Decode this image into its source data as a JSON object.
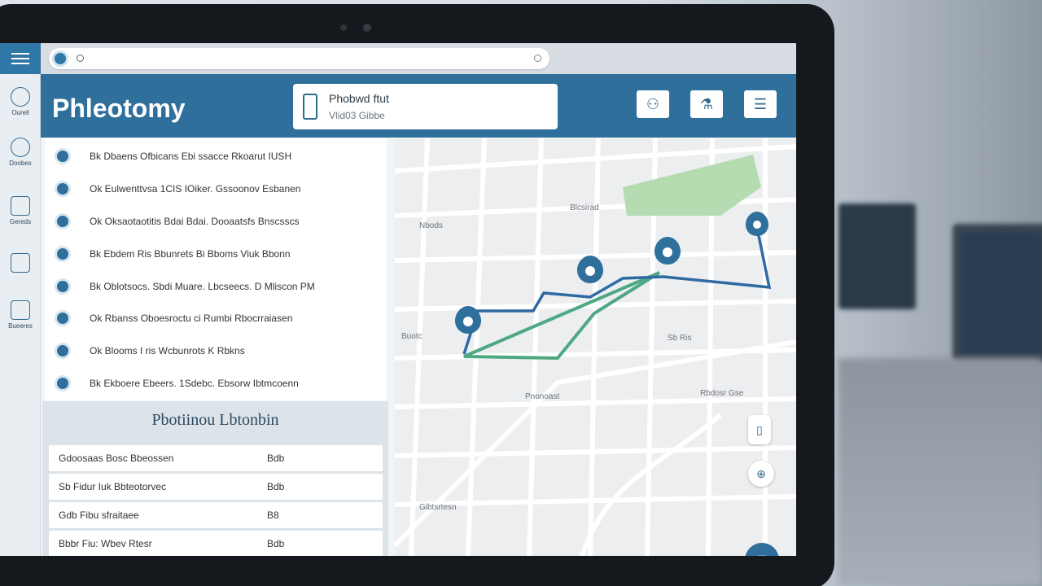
{
  "app": {
    "title": "Phleotomy"
  },
  "search_card": {
    "title": "Phobwd ftut",
    "subtitle": "Vlid03 Gibbe"
  },
  "sidebar": {
    "items": [
      {
        "label": "Ourell",
        "icon": "globe-icon"
      },
      {
        "label": "Doobes",
        "icon": "network-icon"
      },
      {
        "label": "Gereds",
        "icon": "grid-icon"
      },
      {
        "label": "",
        "icon": "columns-icon"
      },
      {
        "label": "Bueeres",
        "icon": "book-icon"
      }
    ]
  },
  "header_buttons": [
    {
      "icon": "people-icon",
      "glyph": "⚇"
    },
    {
      "icon": "flask-icon",
      "glyph": "⚗"
    },
    {
      "icon": "list-icon",
      "glyph": "☰"
    }
  ],
  "patient_list": [
    "Bk Dbaens Ofbicans Ebi ssacce Rkoarut IUSH",
    "Ok Eulwenttvsa 1CIS IOiker. Gssoonov Esbanen",
    "Ok Oksaotaotitis Bdai Bdai. Dooaatsfs Bnscsscs",
    "Bk Ebdem Ris Bbunrets Bi Bboms Viuk Bbonn",
    "Bk Oblotsocs. Sbdi Muare. Lbcseecs. D Mliscon PM",
    "Ok Rbanss Oboesroctu ci Rumbi Rbocrraiasen",
    "Ok Blooms I ris Wcbunrots K Rbkns",
    "Bk Ekboere Ebeers. 1Sdebc. Ebsorw Ibtmcoenn"
  ],
  "bottom_panel": {
    "title": "Pbotiinou Lbtonbin",
    "rows": [
      {
        "name": "Gdoosaas Bosc Bbeossen",
        "value": "Bdb"
      },
      {
        "name": "Sb Fidur Iuk Bbteotorvec",
        "value": "Bdb"
      },
      {
        "name": "Gdb Fibu sfraitaee",
        "value": "B8"
      },
      {
        "name": "Bbbr Fiu: Wbev Rtesr",
        "value": "Bdb"
      }
    ]
  },
  "map": {
    "labels": [
      {
        "text": "Nbods",
        "id": "label-nbods"
      },
      {
        "text": "Blcsirad",
        "id": "label-blcsirad"
      },
      {
        "text": "Sb Ris",
        "id": "label-sb-ris"
      },
      {
        "text": "Pnonoast",
        "id": "label-pnonoast"
      },
      {
        "text": "Rbdosr Gse",
        "id": "label-rbdosr-gse"
      },
      {
        "text": "Buotc",
        "id": "label-buotc"
      },
      {
        "text": "Glbtsrtesn",
        "id": "label-glbtsrtesn"
      }
    ],
    "route_color": "#2f6aa3",
    "alt_route_color": "#4ea882",
    "park_color": "#b5dbb0",
    "pin_color": "#2f6f9c"
  },
  "colors": {
    "accent": "#2f6f9c",
    "header_bg": "#2f6f9c"
  }
}
